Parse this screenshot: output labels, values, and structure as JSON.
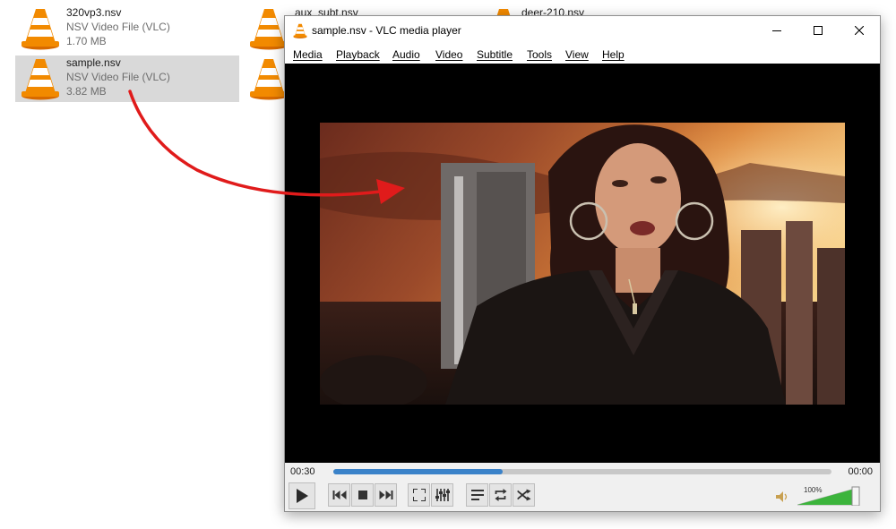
{
  "explorer": {
    "files": [
      {
        "name": "320vp3.nsv",
        "type": "NSV Video File (VLC)",
        "size": "1.70 MB"
      },
      {
        "name": "sample.nsv",
        "type": "NSV Video File (VLC)",
        "size": "3.82 MB"
      },
      {
        "name": "aux_subt.nsv",
        "type": "",
        "size": ""
      },
      {
        "name": "",
        "type": "",
        "size": ""
      },
      {
        "name": "deer-210.nsv",
        "type": "",
        "size": ""
      }
    ]
  },
  "vlc": {
    "title": "sample.nsv - VLC media player",
    "menu": [
      "Media",
      "Playback",
      "Audio",
      "Video",
      "Subtitle",
      "Tools",
      "View",
      "Help"
    ],
    "elapsed": "00:30",
    "total": "00:00",
    "progress": 0.34,
    "volume_label": "100%",
    "volume": 1.0
  },
  "colors": {
    "vlc_orange": "#f28a00",
    "seek_fill": "#3a82c9",
    "volume_green": "#3cb43c",
    "arrow_red": "#e01b1b"
  },
  "icons": [
    "vlc-cone-icon",
    "play-icon",
    "previous-icon",
    "stop-icon",
    "next-icon",
    "fullscreen-icon",
    "extended-settings-icon",
    "playlist-icon",
    "loop-icon",
    "shuffle-icon",
    "speaker-icon"
  ]
}
